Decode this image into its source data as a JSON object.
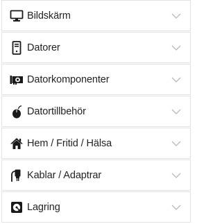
{
  "menu": {
    "items": [
      {
        "label": "Bildskärm",
        "icon": "monitor-icon"
      },
      {
        "label": "Datorer",
        "icon": "computer-tower-icon"
      },
      {
        "label": "Datorkomponenter",
        "icon": "graphics-card-icon"
      },
      {
        "label": "Datortillbehör",
        "icon": "mouse-icon"
      },
      {
        "label": "Hem / Fritid / Hälsa",
        "icon": "home-icon"
      },
      {
        "label": "Kablar / Adaptrar",
        "icon": "cable-plug-icon"
      },
      {
        "label": "Lagring",
        "icon": "storage-drive-icon"
      }
    ],
    "expand_icon": "chevron-down-icon"
  },
  "colors": {
    "text": "#222222",
    "icon": "#1a1a1a",
    "border": "#e2e2e2",
    "chevron": "#b8b8b8",
    "background": "#ffffff"
  }
}
